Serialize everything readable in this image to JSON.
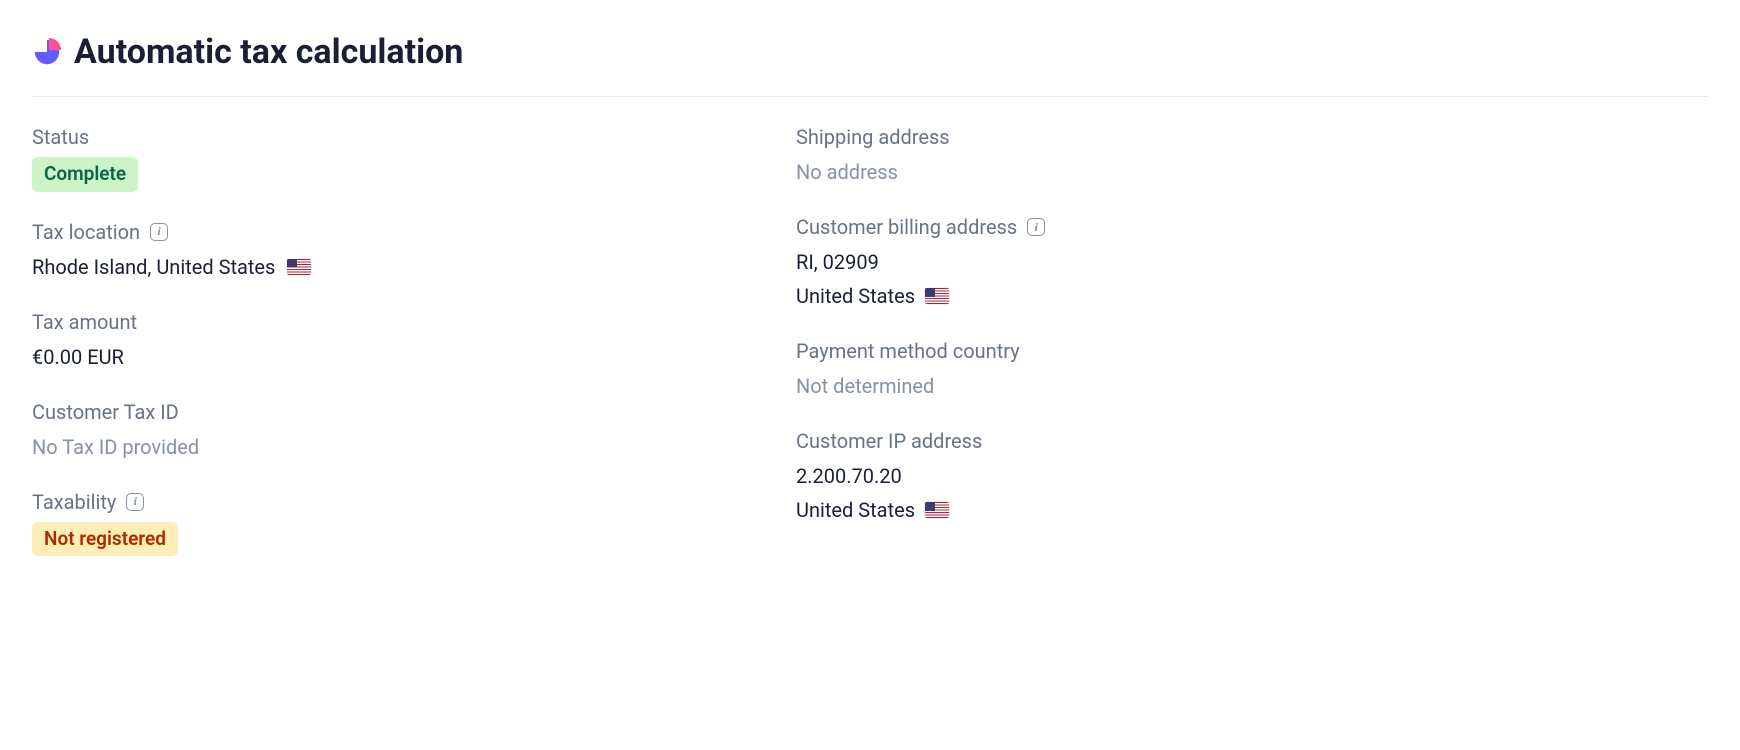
{
  "header": {
    "title": "Automatic tax calculation"
  },
  "left": {
    "status": {
      "label": "Status",
      "badge": "Complete"
    },
    "tax_location": {
      "label": "Tax location",
      "value": "Rhode Island, United States"
    },
    "tax_amount": {
      "label": "Tax amount",
      "value": "€0.00 EUR"
    },
    "customer_tax_id": {
      "label": "Customer Tax ID",
      "value": "No Tax ID provided"
    },
    "taxability": {
      "label": "Taxability",
      "badge": "Not registered"
    }
  },
  "right": {
    "shipping_address": {
      "label": "Shipping address",
      "value": "No address"
    },
    "billing_address": {
      "label": "Customer billing address",
      "line1": "RI, 02909",
      "line2": "United States"
    },
    "payment_method_country": {
      "label": "Payment method country",
      "value": "Not determined"
    },
    "customer_ip": {
      "label": "Customer IP address",
      "ip": "2.200.70.20",
      "country": "United States"
    }
  }
}
